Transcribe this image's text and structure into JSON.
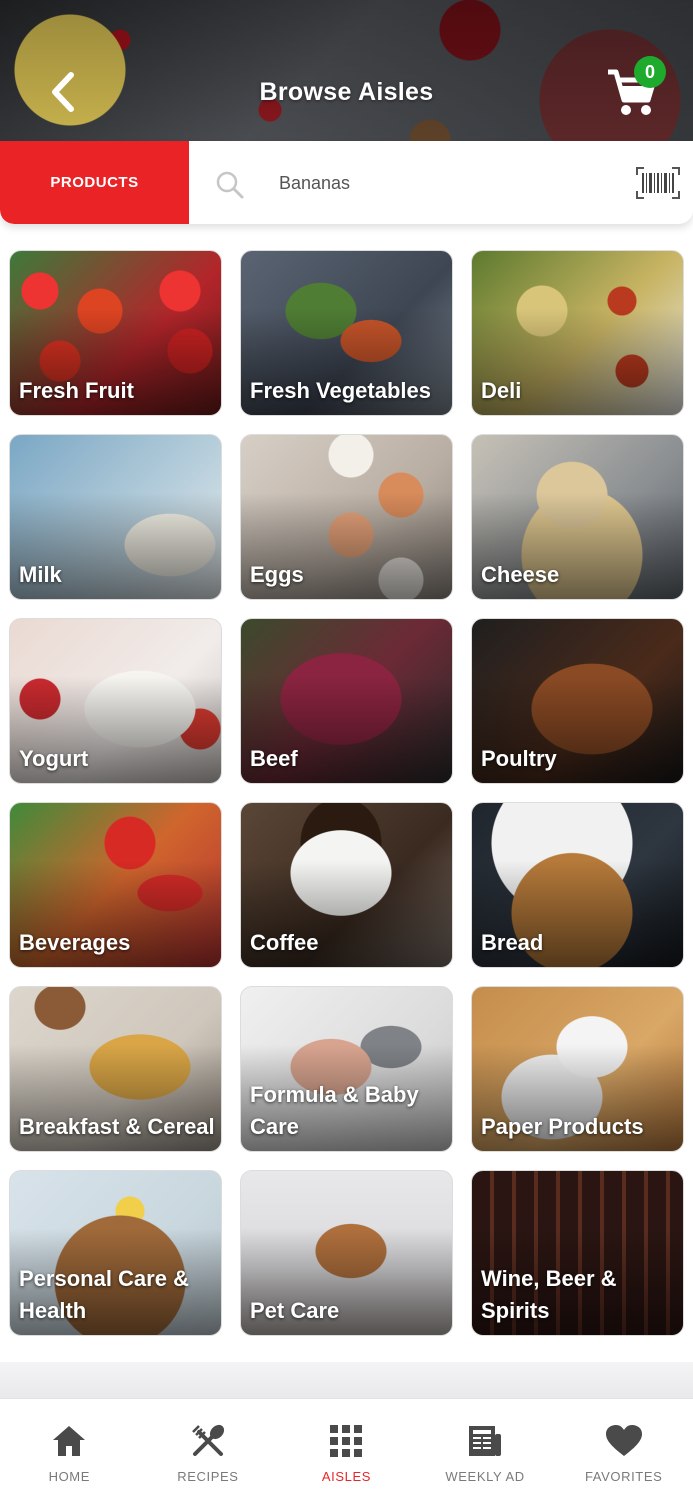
{
  "header": {
    "title": "Browse Aisles",
    "back_icon": "chevron-left-icon",
    "cart_icon": "cart-icon",
    "cart_count": "0"
  },
  "search": {
    "products_label": "PRODUCTS",
    "placeholder": "Bananas",
    "value": "",
    "search_icon": "search-icon",
    "barcode_icon": "barcode-icon"
  },
  "aisles": [
    {
      "label": "Fresh Fruit"
    },
    {
      "label": "Fresh Vegetables"
    },
    {
      "label": "Deli"
    },
    {
      "label": "Milk"
    },
    {
      "label": "Eggs"
    },
    {
      "label": "Cheese"
    },
    {
      "label": "Yogurt"
    },
    {
      "label": "Beef"
    },
    {
      "label": "Poultry"
    },
    {
      "label": "Beverages"
    },
    {
      "label": "Coffee"
    },
    {
      "label": "Bread"
    },
    {
      "label": "Breakfast & Cereal"
    },
    {
      "label": "Formula & Baby Care"
    },
    {
      "label": "Paper Products"
    },
    {
      "label": "Personal Care & Health"
    },
    {
      "label": "Pet Care"
    },
    {
      "label": "Wine, Beer & Spirits"
    }
  ],
  "bottom_nav": {
    "items": [
      {
        "label": "HOME",
        "icon": "home-icon"
      },
      {
        "label": "RECIPES",
        "icon": "utensils-icon"
      },
      {
        "label": "AISLES",
        "icon": "grid-icon",
        "active": true
      },
      {
        "label": "WEEKLY AD",
        "icon": "newspaper-icon"
      },
      {
        "label": "FAVORITES",
        "icon": "heart-icon"
      }
    ]
  },
  "colors": {
    "accent": "#ea2327",
    "badge": "#1eaa2d",
    "nav_icon": "#4a4a4a",
    "nav_label": "#7a7a7a"
  }
}
